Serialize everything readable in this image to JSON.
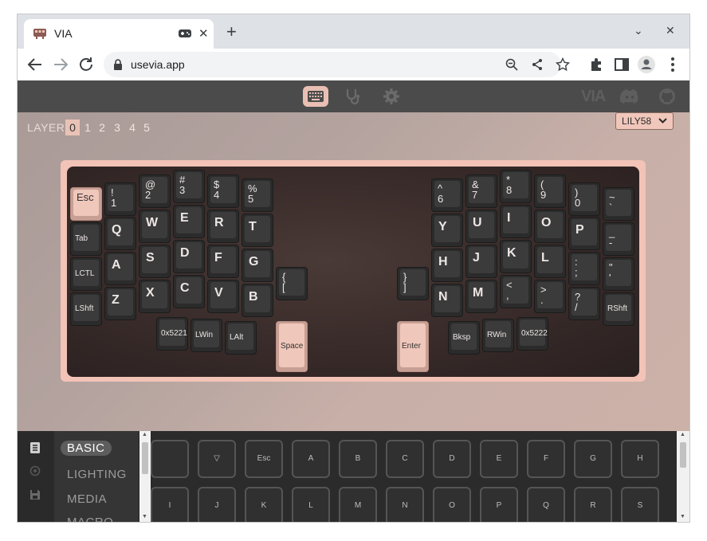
{
  "browser": {
    "tab_title": "VIA",
    "url": "usevia.app"
  },
  "app": {
    "layer_label": "LAYER",
    "layers": [
      "0",
      "1",
      "2",
      "3",
      "4",
      "5"
    ],
    "active_layer": "0",
    "keyboard_name": "LILY58",
    "brand_logo_text": "VIA",
    "colors": {
      "accent": "#f0c7bb",
      "navbar": "#4b4b4b",
      "key": "#3b3b3b"
    }
  },
  "keys": [
    {
      "id": "esc",
      "label": "Esc"
    },
    {
      "id": "n1",
      "label": "!\n1"
    },
    {
      "id": "n2",
      "label": "@\n2"
    },
    {
      "id": "n3",
      "label": "#\n3"
    },
    {
      "id": "n4",
      "label": "$\n4"
    },
    {
      "id": "n5",
      "label": "%\n5"
    },
    {
      "id": "tab",
      "label": "Tab"
    },
    {
      "id": "q",
      "label": "Q"
    },
    {
      "id": "w",
      "label": "W"
    },
    {
      "id": "e",
      "label": "E"
    },
    {
      "id": "r",
      "label": "R"
    },
    {
      "id": "t",
      "label": "T"
    },
    {
      "id": "lctl",
      "label": "LCTL"
    },
    {
      "id": "a",
      "label": "A"
    },
    {
      "id": "s",
      "label": "S"
    },
    {
      "id": "d",
      "label": "D"
    },
    {
      "id": "f",
      "label": "F"
    },
    {
      "id": "g",
      "label": "G"
    },
    {
      "id": "lbrace",
      "label": "{\n["
    },
    {
      "id": "lshft",
      "label": "LShft"
    },
    {
      "id": "z",
      "label": "Z"
    },
    {
      "id": "x",
      "label": "X"
    },
    {
      "id": "c",
      "label": "C"
    },
    {
      "id": "v",
      "label": "V"
    },
    {
      "id": "b",
      "label": "B"
    },
    {
      "id": "m0x5221",
      "label": "0x5221"
    },
    {
      "id": "lwin",
      "label": "LWin"
    },
    {
      "id": "lalt",
      "label": "LAlt"
    },
    {
      "id": "space",
      "label": "Space"
    },
    {
      "id": "n6",
      "label": "^\n6"
    },
    {
      "id": "n7",
      "label": "&\n7"
    },
    {
      "id": "n8",
      "label": "*\n8"
    },
    {
      "id": "n9",
      "label": "(\n9"
    },
    {
      "id": "n0",
      "label": ")\n0"
    },
    {
      "id": "tilde",
      "label": "~\n`"
    },
    {
      "id": "y",
      "label": "Y"
    },
    {
      "id": "u",
      "label": "U"
    },
    {
      "id": "i",
      "label": "I"
    },
    {
      "id": "o",
      "label": "O"
    },
    {
      "id": "p",
      "label": "P"
    },
    {
      "id": "minus",
      "label": "_\n-"
    },
    {
      "id": "rbrace",
      "label": "}\n]"
    },
    {
      "id": "h",
      "label": "H"
    },
    {
      "id": "j",
      "label": "J"
    },
    {
      "id": "k",
      "label": "K"
    },
    {
      "id": "l",
      "label": "L"
    },
    {
      "id": "semi",
      "label": ":\n;"
    },
    {
      "id": "quote",
      "label": "\"\n'"
    },
    {
      "id": "n",
      "label": "N"
    },
    {
      "id": "m",
      "label": "M"
    },
    {
      "id": "comma",
      "label": "<\n,"
    },
    {
      "id": "dot",
      "label": ">\n."
    },
    {
      "id": "slash",
      "label": "?\n/"
    },
    {
      "id": "rshft",
      "label": "RShft"
    },
    {
      "id": "enter",
      "label": "Enter"
    },
    {
      "id": "bksp",
      "label": "Bksp"
    },
    {
      "id": "rwin",
      "label": "RWin"
    },
    {
      "id": "m0x5222",
      "label": "0x5222"
    }
  ],
  "menu": {
    "items": [
      "BASIC",
      "LIGHTING",
      "MEDIA",
      "MACRO"
    ],
    "active": "BASIC"
  },
  "palette": {
    "row1": [
      "",
      "▽",
      "Esc",
      "A",
      "B",
      "C",
      "D",
      "E",
      "F",
      "G",
      "H"
    ],
    "row2": [
      "I",
      "J",
      "K",
      "L",
      "M",
      "N",
      "O",
      "P",
      "Q",
      "R",
      "S"
    ]
  }
}
